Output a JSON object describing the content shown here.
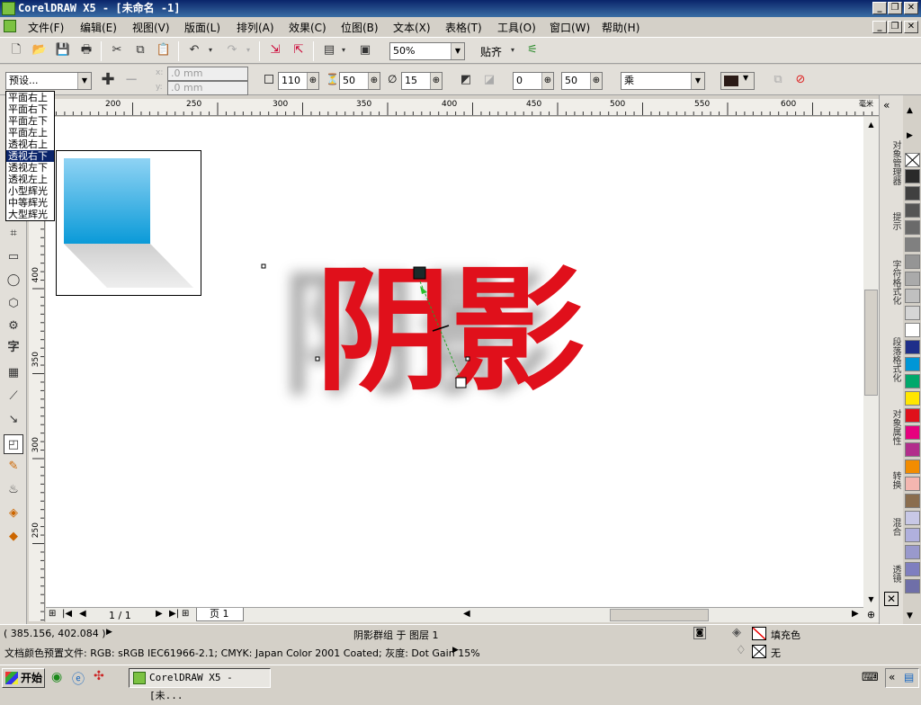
{
  "window": {
    "title": "CorelDRAW X5 - [未命名 -1]",
    "min": "_",
    "restore": "❐",
    "close": "✕"
  },
  "menu": [
    "文件(F)",
    "编辑(E)",
    "视图(V)",
    "版面(L)",
    "排列(A)",
    "效果(C)",
    "位图(B)",
    "文本(X)",
    "表格(T)",
    "工具(O)",
    "窗口(W)",
    "帮助(H)"
  ],
  "toolbar": {
    "zoom": "50%",
    "snap_label": "贴齐"
  },
  "property_bar": {
    "preset": "预设...",
    "pos_x": ".0 mm",
    "pos_y": ".0 mm",
    "opacity": "110",
    "feather": "50",
    "angle": "15",
    "fade": "0",
    "stretch": "50",
    "merge_mode": "乘"
  },
  "preset_list": {
    "items": [
      "平面右上",
      "平面右下",
      "平面左下",
      "平面左上",
      "透视右上",
      "透视右下",
      "透视左下",
      "透视左上",
      "小型辉光",
      "中等辉光",
      "大型辉光"
    ],
    "selected_index": 5
  },
  "ruler": {
    "unit": "毫米",
    "h_ticks": [
      "200",
      "250",
      "300",
      "350",
      "400",
      "450",
      "500",
      "550",
      "600"
    ],
    "v_ticks": [
      "400",
      "350",
      "300",
      "250"
    ]
  },
  "canvas": {
    "artwork_text": "阴影",
    "text_color": "#e0101b"
  },
  "dockers": [
    "对象管理器",
    "提示",
    "字符格式化",
    "段落格式化",
    "对象属性",
    "转换",
    "混合",
    "透镜"
  ],
  "palette": [
    "#2a2a2a",
    "#404040",
    "#555555",
    "#6a6a6a",
    "#808080",
    "#959595",
    "#aaaaaa",
    "#c0c0c0",
    "#d5d5d5",
    "#ffffff",
    "#1f2f8a",
    "#0096d6",
    "#00a86b",
    "#ffe600",
    "#e0101b",
    "#e6007e",
    "#b22e8c",
    "#f28c00",
    "#f4b6b0",
    "#8a6d4e",
    "#c8c8e6",
    "#b0b0dd",
    "#9999cc",
    "#7f7fbf",
    "#6f6fa8"
  ],
  "page_nav": {
    "counter": "1 / 1",
    "tab": "页 1"
  },
  "status": {
    "coords": "( 385.156, 402.084 )",
    "selection": "阴影群组 于 图层 1",
    "fill_label": "填充色",
    "outline_label": "无",
    "color_profile": "文档颜色预置文件: RGB: sRGB IEC61966-2.1; CMYK: Japan Color 2001 Coated; 灰度: Dot Gain 15%"
  },
  "taskbar": {
    "start": "开始",
    "task": "CorelDRAW X5 - [未..."
  }
}
